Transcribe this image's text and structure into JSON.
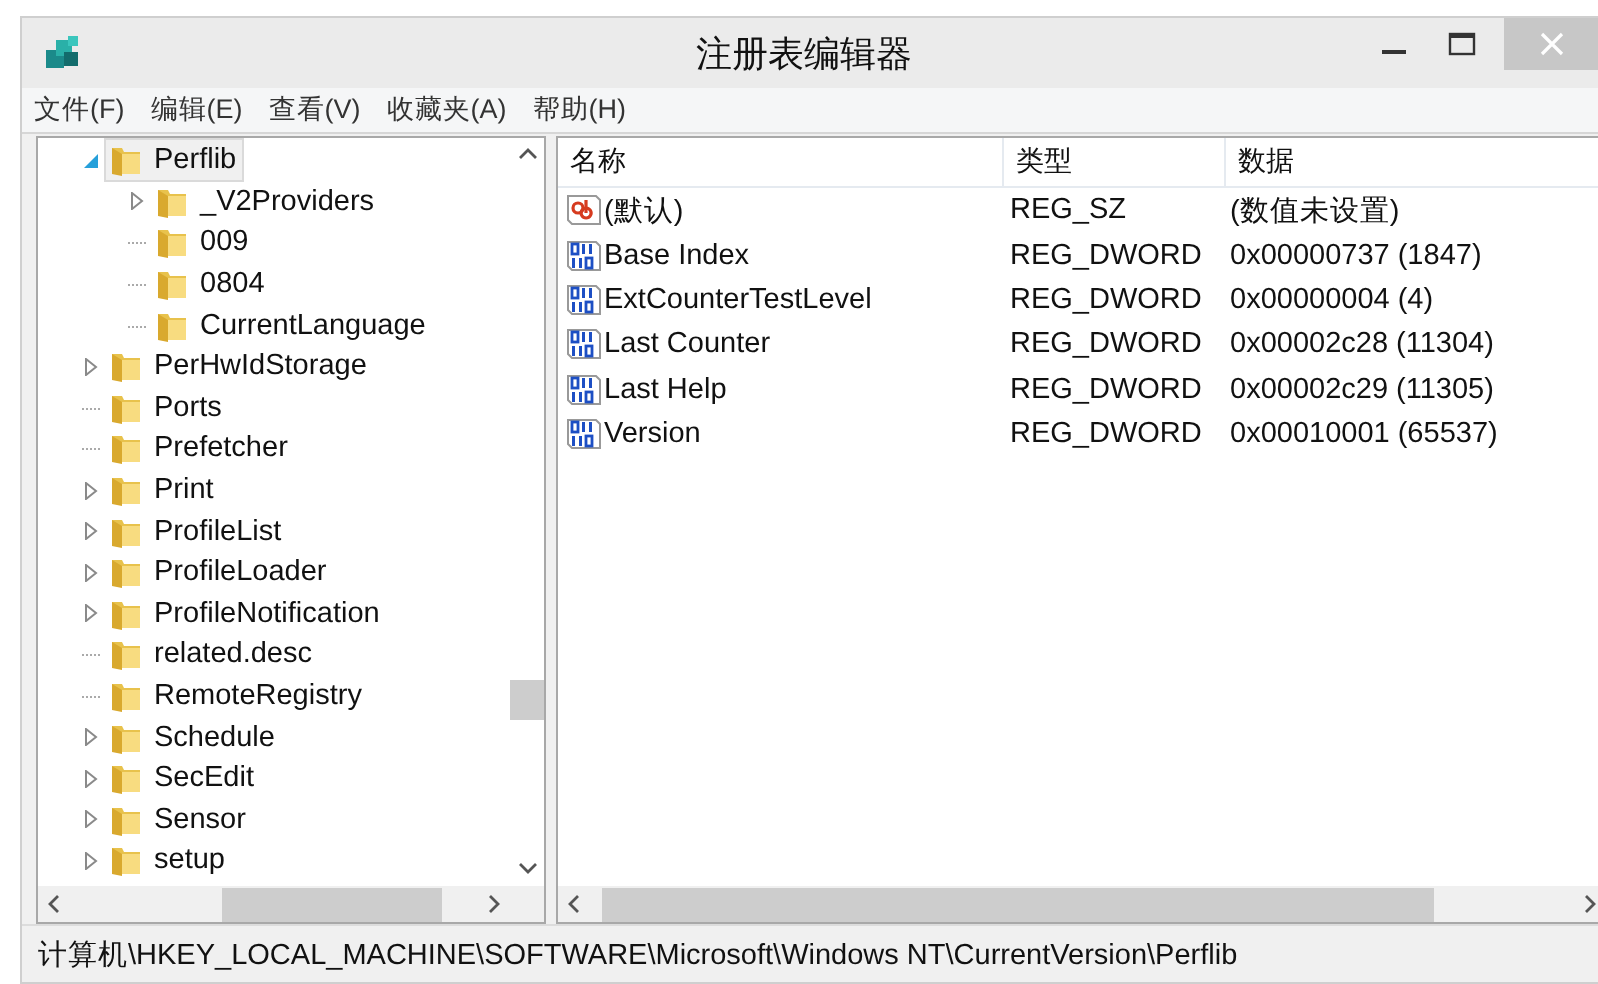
{
  "window": {
    "title": "注册表编辑器"
  },
  "menu": [
    "文件(F)",
    "编辑(E)",
    "查看(V)",
    "收藏夹(A)",
    "帮助(H)"
  ],
  "tree": [
    {
      "label": "Perflib",
      "selected": true,
      "expandable": true,
      "expanded": true,
      "children": [
        {
          "label": "_V2Providers",
          "selected": false,
          "expandable": true,
          "expanded": false
        },
        {
          "label": "009",
          "selected": false,
          "expandable": false
        },
        {
          "label": "0804",
          "selected": false,
          "expandable": false
        },
        {
          "label": "CurrentLanguage",
          "selected": false,
          "expandable": false
        }
      ]
    },
    {
      "label": "PerHwIdStorage",
      "selected": false,
      "expandable": true,
      "expanded": false
    },
    {
      "label": "Ports",
      "selected": false,
      "expandable": false
    },
    {
      "label": "Prefetcher",
      "selected": false,
      "expandable": false
    },
    {
      "label": "Print",
      "selected": false,
      "expandable": true,
      "expanded": false
    },
    {
      "label": "ProfileList",
      "selected": false,
      "expandable": true,
      "expanded": false
    },
    {
      "label": "ProfileLoader",
      "selected": false,
      "expandable": true,
      "expanded": false
    },
    {
      "label": "ProfileNotification",
      "selected": false,
      "expandable": true,
      "expanded": false
    },
    {
      "label": "related.desc",
      "selected": false,
      "expandable": false
    },
    {
      "label": "RemoteRegistry",
      "selected": false,
      "expandable": false
    },
    {
      "label": "Schedule",
      "selected": false,
      "expandable": true,
      "expanded": false
    },
    {
      "label": "SecEdit",
      "selected": false,
      "expandable": true,
      "expanded": false
    },
    {
      "label": "Sensor",
      "selected": false,
      "expandable": true,
      "expanded": false
    },
    {
      "label": "setup",
      "selected": false,
      "expandable": true,
      "expanded": false
    }
  ],
  "values": {
    "columns": [
      "名称",
      "类型",
      "数据"
    ],
    "rows": [
      {
        "kind": "string",
        "name": "(默认)",
        "type": "REG_SZ",
        "data": "(数值未设置)"
      },
      {
        "kind": "dword",
        "name": "Base Index",
        "type": "REG_DWORD",
        "data": "0x00000737 (1847)"
      },
      {
        "kind": "dword",
        "name": "ExtCounterTestLevel",
        "type": "REG_DWORD",
        "data": "0x00000004 (4)"
      },
      {
        "kind": "dword",
        "name": "Last Counter",
        "type": "REG_DWORD",
        "data": "0x00002c28 (11304)"
      },
      {
        "kind": "dword",
        "name": "Last Help",
        "type": "REG_DWORD",
        "data": "0x00002c29 (11305)"
      },
      {
        "kind": "dword",
        "name": "Version",
        "type": "REG_DWORD",
        "data": "0x00010001 (65537)"
      }
    ]
  },
  "status_bar": "计算机\\HKEY_LOCAL_MACHINE\\SOFTWARE\\Microsoft\\Windows NT\\CurrentVersion\\Perflib"
}
